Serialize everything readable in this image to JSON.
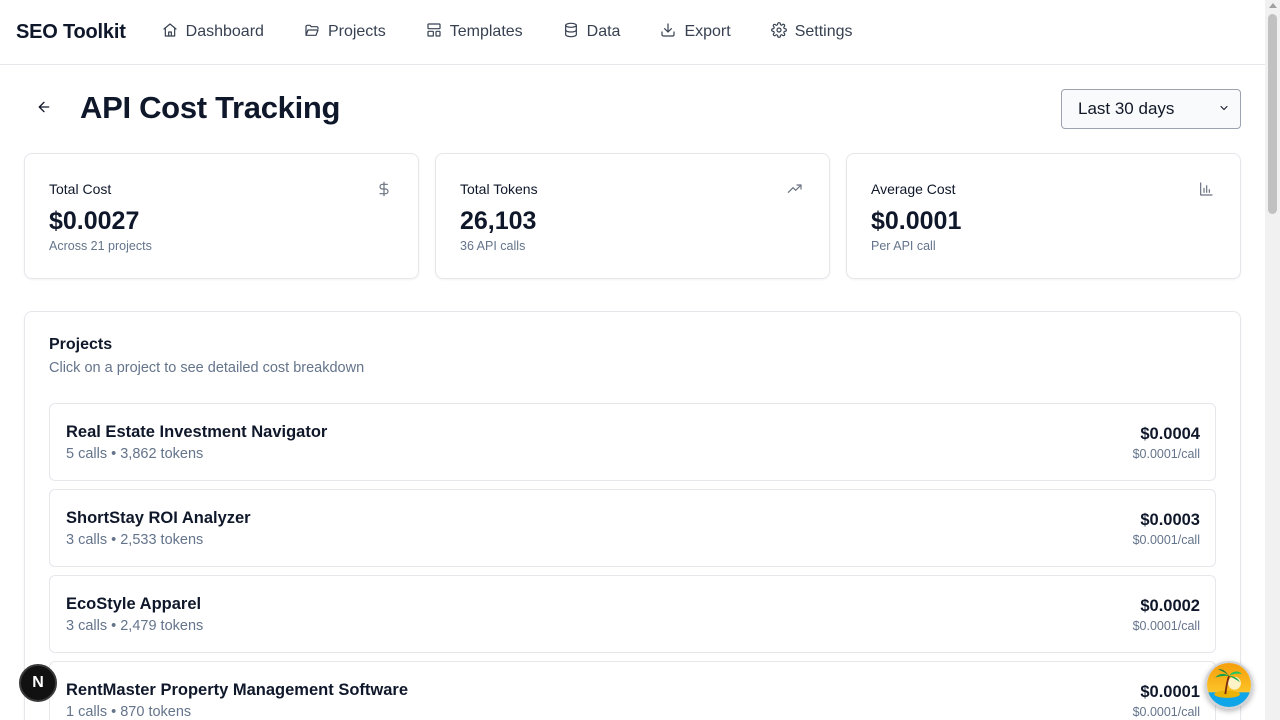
{
  "app": {
    "brand": "SEO Toolkit"
  },
  "nav": {
    "items": [
      {
        "label": "Dashboard",
        "icon": "home-icon"
      },
      {
        "label": "Projects",
        "icon": "folder-open-icon"
      },
      {
        "label": "Templates",
        "icon": "layout-icon"
      },
      {
        "label": "Data",
        "icon": "database-icon"
      },
      {
        "label": "Export",
        "icon": "download-icon"
      },
      {
        "label": "Settings",
        "icon": "gear-icon"
      }
    ]
  },
  "header": {
    "title": "API Cost Tracking",
    "date_range": "Last 30 days"
  },
  "stats": [
    {
      "label": "Total Cost",
      "value": "$0.0027",
      "sub": "Across 21 projects",
      "icon": "dollar-icon"
    },
    {
      "label": "Total Tokens",
      "value": "26,103",
      "sub": "36 API calls",
      "icon": "trending-up-icon"
    },
    {
      "label": "Average Cost",
      "value": "$0.0001",
      "sub": "Per API call",
      "icon": "bar-chart-icon"
    }
  ],
  "projects": {
    "title": "Projects",
    "description": "Click on a project to see detailed cost breakdown",
    "rows": [
      {
        "name": "Real Estate Investment Navigator",
        "meta": "5 calls • 3,862 tokens",
        "cost": "$0.0004",
        "per_call": "$0.0001/call"
      },
      {
        "name": "ShortStay ROI Analyzer",
        "meta": "3 calls • 2,533 tokens",
        "cost": "$0.0003",
        "per_call": "$0.0001/call"
      },
      {
        "name": "EcoStyle Apparel",
        "meta": "3 calls • 2,479 tokens",
        "cost": "$0.0002",
        "per_call": "$0.0001/call"
      },
      {
        "name": "RentMaster Property Management Software",
        "meta": "1 calls • 870 tokens",
        "cost": "$0.0001",
        "per_call": "$0.0001/call"
      }
    ]
  },
  "floating": {
    "badge_letter": "N"
  },
  "colors": {
    "text_primary": "#0f172a",
    "text_muted": "#64748b",
    "border": "#e5e7eb"
  }
}
